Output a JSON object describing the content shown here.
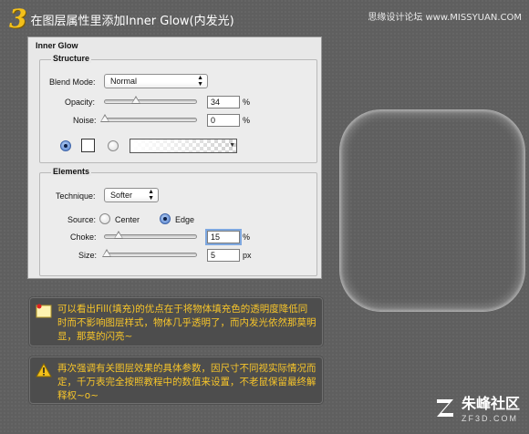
{
  "header": {
    "step_number": "3",
    "step_title": "在图层属性里添加Inner Glow(内发光)",
    "site_credit": "思缘设计论坛 www.MISSYUAN.COM"
  },
  "panel": {
    "title": "Inner Glow",
    "structure": {
      "label": "Structure",
      "blend_mode_label": "Blend Mode:",
      "blend_mode_value": "Normal",
      "opacity_label": "Opacity:",
      "opacity_value": "34",
      "opacity_unit": "%",
      "opacity_level": 0.34,
      "noise_label": "Noise:",
      "noise_value": "0",
      "noise_unit": "%",
      "noise_level": 0
    },
    "elements": {
      "label": "Elements",
      "technique_label": "Technique:",
      "technique_value": "Softer",
      "source_label": "Source:",
      "source_center": "Center",
      "source_edge": "Edge",
      "source_selected": "Edge",
      "choke_label": "Choke:",
      "choke_value": "15",
      "choke_unit": "%",
      "choke_level": 0.15,
      "size_label": "Size:",
      "size_value": "5",
      "size_unit": "px",
      "size_level": 0.02
    }
  },
  "notes": [
    {
      "icon": "sticky-note-icon",
      "text": "可以看出Fill(填充)的优点在于将物体填充色的透明度降低同时而不影响图层样式，物体几乎透明了，而内发光依然那莫明显，那莫的闪亮~"
    },
    {
      "icon": "warning-icon",
      "text": "再次强调有关图层效果的具体参数，因尺寸不同视实际情况而定，千万表完全按照教程中的数值来设置，不老鼠保留最终解释权~o~"
    }
  ],
  "watermark": {
    "cn": "朱峰社区",
    "url": "ZF3D.COM"
  },
  "colors": {
    "accent_yellow": "#f3c01a",
    "note_text": "#f7c52a",
    "background": "#5f5f5f",
    "radio_selected": "#5b86cf"
  }
}
